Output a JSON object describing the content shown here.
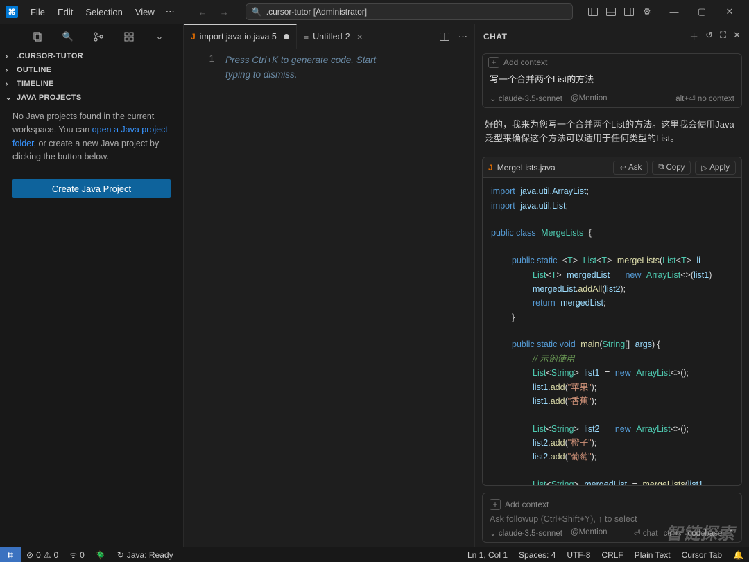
{
  "titlebar": {
    "menus": [
      "File",
      "Edit",
      "Selection",
      "View"
    ],
    "omnibox": ".cursor-tutor [Administrator]"
  },
  "sidebar": {
    "sections": [
      {
        "label": ".CURSOR-TUTOR",
        "open": false
      },
      {
        "label": "OUTLINE",
        "open": false
      },
      {
        "label": "TIMELINE",
        "open": false
      },
      {
        "label": "JAVA PROJECTS",
        "open": true
      }
    ],
    "javaProjects": {
      "msg1": "No Java projects found in the current workspace. You can ",
      "link": "open a Java project folder",
      "msg2": ", or create a new Java project by clicking the button below.",
      "button": "Create Java Project"
    }
  },
  "editor": {
    "tabs": [
      {
        "kind": "java",
        "label": "import java.io.java 5",
        "dirty": true,
        "active": true
      },
      {
        "kind": "file",
        "label": "Untitled-2",
        "dirty": false,
        "active": false
      }
    ],
    "lineno": "1",
    "placeholder1": "Press Ctrl+K to generate code. Start",
    "placeholder2": "typing to dismiss."
  },
  "chat": {
    "title": "CHAT",
    "addContext": "Add context",
    "prompt": "写一个合并两个List的方法",
    "model": "claude-3.5-sonnet",
    "mention": "@Mention",
    "noctx": "alt+⏎ no context",
    "reply": "好的，我来为您写一个合并两个List的方法。这里我会使用Java泛型来确保这个方法可以适用于任何类型的List。",
    "codefile": "MergeLists.java",
    "actions": {
      "ask": "Ask",
      "copy": "Copy",
      "apply": "Apply"
    },
    "followup": {
      "addContext": "Add context",
      "placeholder": "Ask followup (Ctrl+Shift+Y), ↑ to select",
      "model": "claude-3.5-sonnet",
      "mention": "@Mention",
      "hints": {
        "chat": "⏎ chat",
        "codebase": "ctrl+⏎ codebase",
        "more": "⌃"
      }
    }
  },
  "status": {
    "errors": "0",
    "warnings": "0",
    "ports": "0",
    "java": "Java: Ready",
    "ln": "Ln 1, Col 1",
    "spaces": "Spaces: 4",
    "enc": "UTF-8",
    "eol": "CRLF",
    "lang": "Plain Text",
    "cursor": "Cursor Tab"
  },
  "watermark": "智链探索"
}
